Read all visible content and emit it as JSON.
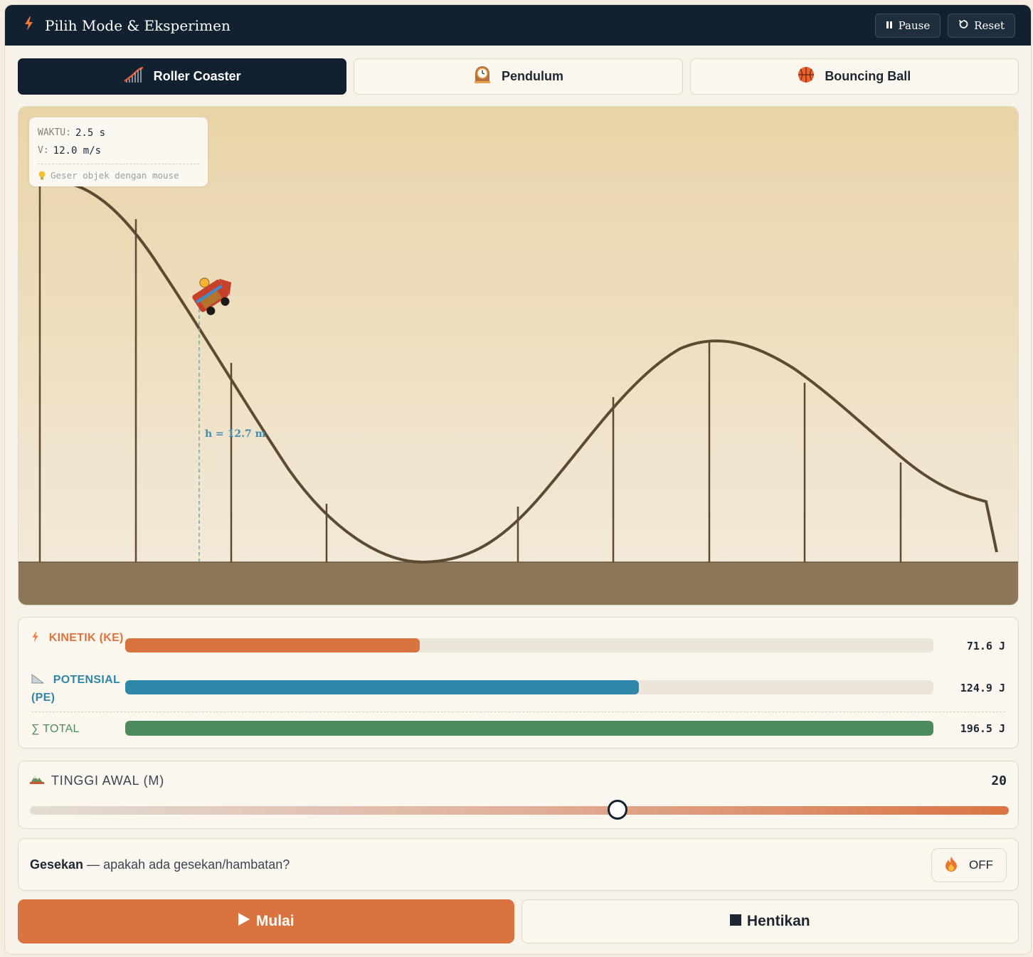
{
  "header": {
    "title": "Pilih Mode & Eksperimen",
    "pause_label": "Pause",
    "reset_label": "Reset"
  },
  "tabs": [
    {
      "label": "Roller Coaster",
      "icon": "roller-coaster-icon",
      "active": true
    },
    {
      "label": "Pendulum",
      "icon": "pendulum-clock-icon",
      "active": false
    },
    {
      "label": "Bouncing Ball",
      "icon": "basketball-icon",
      "active": false
    }
  ],
  "sim": {
    "time_label": "WAKTU:",
    "time_value": "2.5 s",
    "velocity_label": "V:",
    "velocity_value": "12.0 m/s",
    "tip": "Geser objek dengan mouse",
    "height_label": "h = 12.7 m"
  },
  "energy": {
    "kinetic": {
      "label": "KINETIK (KE)",
      "value": "71.6 J",
      "fraction": 0.364,
      "color": "#d97440"
    },
    "potential": {
      "label": "POTENSIAL (PE)",
      "value": "124.9 J",
      "fraction": 0.636,
      "color": "#2e87a8"
    },
    "total": {
      "label": "∑ TOTAL",
      "value": "196.5 J",
      "fraction": 1.0,
      "color": "#4b8b5e"
    }
  },
  "height_slider": {
    "label": "TINGGI AWAL (M)",
    "value": "20",
    "fraction": 0.6
  },
  "friction": {
    "title": "Gesekan",
    "question": " — apakah ada gesekan/hambatan?",
    "state": "OFF"
  },
  "actions": {
    "start_label": "Mulai",
    "stop_label": "Hentikan"
  }
}
